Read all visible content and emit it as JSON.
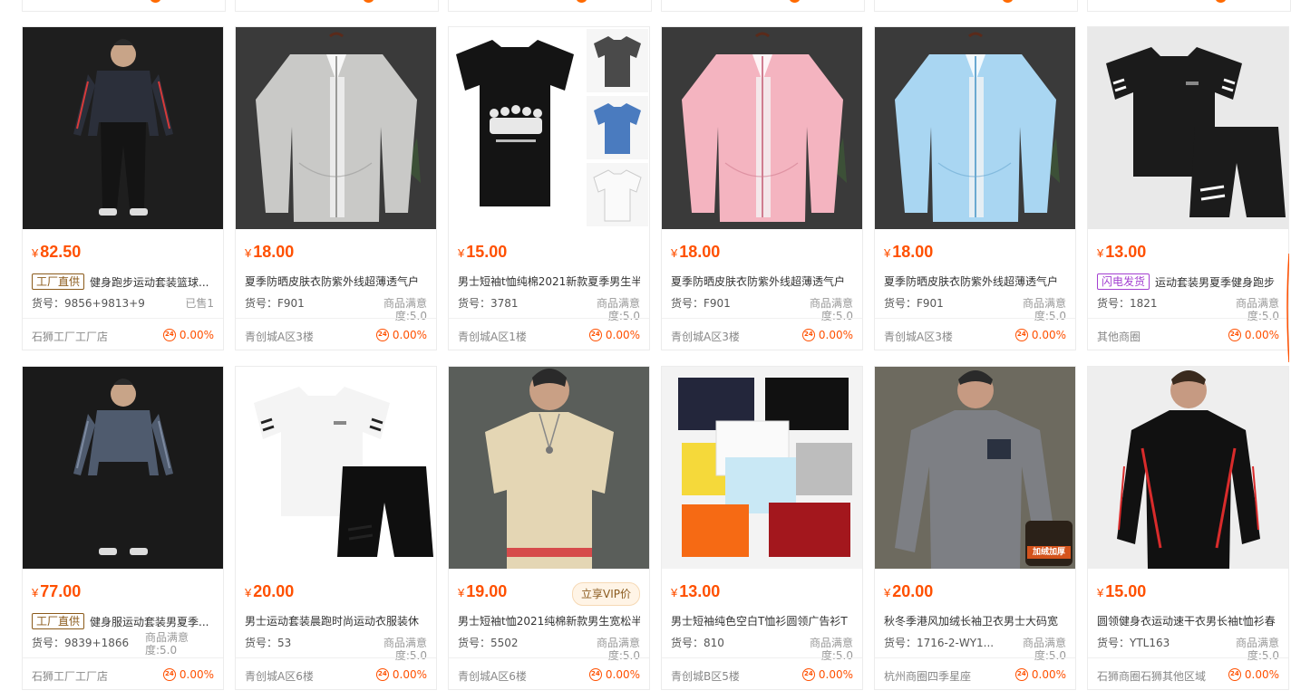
{
  "products": [
    {
      "price": "82.50",
      "currency": "¥",
      "tag": "工厂直供",
      "tag_type": "factory",
      "title": "健身跑步运动套装篮球...",
      "code": "货号：9856+9813+9...",
      "right_text": "已售1",
      "location": "石狮工厂工厂店",
      "rate": "0.00%",
      "icon": "sportswear-man-photo"
    },
    {
      "price": "18.00",
      "currency": "¥",
      "tag": "",
      "tag_type": "",
      "title": "夏季防晒皮肤衣防紫外线超薄透气户",
      "code": "货号：F901",
      "right_text": "商品满意度:5.0",
      "location": "青创城A区3楼",
      "rate": "0.00%",
      "icon": "grey-jacket-photo"
    },
    {
      "price": "15.00",
      "currency": "¥",
      "tag": "",
      "tag_type": "",
      "title": "男士短袖t恤纯棉2021新款夏季男生半",
      "code": "货号：3781",
      "right_text": "商品满意度:5.0",
      "location": "青创城A区1楼",
      "rate": "0.00%",
      "icon": "black-tshirt-photo"
    },
    {
      "price": "18.00",
      "currency": "¥",
      "tag": "",
      "tag_type": "",
      "title": "夏季防晒皮肤衣防紫外线超薄透气户",
      "code": "货号：F901",
      "right_text": "商品满意度:5.0",
      "location": "青创城A区3楼",
      "rate": "0.00%",
      "icon": "pink-jacket-photo"
    },
    {
      "price": "18.00",
      "currency": "¥",
      "tag": "",
      "tag_type": "",
      "title": "夏季防晒皮肤衣防紫外线超薄透气户",
      "code": "货号：F901",
      "right_text": "商品满意度:5.0",
      "location": "青创城A区3楼",
      "rate": "0.00%",
      "icon": "blue-jacket-photo"
    },
    {
      "price": "13.00",
      "currency": "¥",
      "tag": "闪电发货",
      "tag_type": "flash",
      "title": "运动套装男夏季健身跑步",
      "code": "货号：1821",
      "right_text": "商品满意度:5.0",
      "location": "其他商圈",
      "rate": "0.00%",
      "icon": "black-tee-shorts-set-photo"
    },
    {
      "price": "77.00",
      "currency": "¥",
      "tag": "工厂直供",
      "tag_type": "factory",
      "title": "健身服运动套装男夏季...",
      "code": "货号：9839+1866",
      "right_text": "商品满意度:5.0",
      "right_wrap": true,
      "location": "石狮工厂工厂店",
      "rate": "0.00%",
      "icon": "gym-man-photo"
    },
    {
      "price": "20.00",
      "currency": "¥",
      "tag": "",
      "tag_type": "",
      "title": "男士运动套装晨跑时尚运动衣服装休",
      "code": "货号：53",
      "right_text": "商品满意度:5.0",
      "location": "青创城A区6楼",
      "rate": "0.00%",
      "icon": "white-tee-shorts-set-photo"
    },
    {
      "price": "19.00",
      "currency": "¥",
      "tag": "",
      "tag_type": "",
      "vip": "立享VIP价",
      "title": "男士短袖t恤2021纯棉新款男生宽松半",
      "code": "货号：5502",
      "right_text": "商品满意度:5.0",
      "location": "青创城A区6楼",
      "rate": "0.00%",
      "icon": "beige-tshirt-man-photo"
    },
    {
      "price": "13.00",
      "currency": "¥",
      "tag": "",
      "tag_type": "",
      "title": "男士短袖纯色空白T恤衫圆领广告衫T",
      "code": "货号：810",
      "right_text": "商品满意度:5.0",
      "location": "青创城B区5楼",
      "rate": "0.00%",
      "icon": "color-tshirts-photo"
    },
    {
      "price": "20.00",
      "currency": "¥",
      "tag": "",
      "tag_type": "",
      "title": "秋冬季港风加绒长袖卫衣男士大码宽",
      "code": "货号：1716-2-WY1...",
      "right_text": "商品满意度:5.0",
      "location": "杭州商圈四季星座",
      "rate": "0.00%",
      "icon": "grey-sweatshirt-man-photo",
      "badge_text": "加绒加厚"
    },
    {
      "price": "15.00",
      "currency": "¥",
      "tag": "",
      "tag_type": "",
      "title": "圆领健身衣运动速干衣男长袖t恤衫春",
      "code": "货号：YTL163",
      "right_text": "商品满意度:5.0",
      "location": "石狮商圈石狮其他区域",
      "rate": "0.00%",
      "icon": "compression-shirt-man-photo"
    }
  ],
  "badge_icon_text": "24",
  "colors": {
    "price": "#ff5000",
    "factory_tag": "#8b5a1a",
    "flash_tag": "#a33fd1"
  }
}
